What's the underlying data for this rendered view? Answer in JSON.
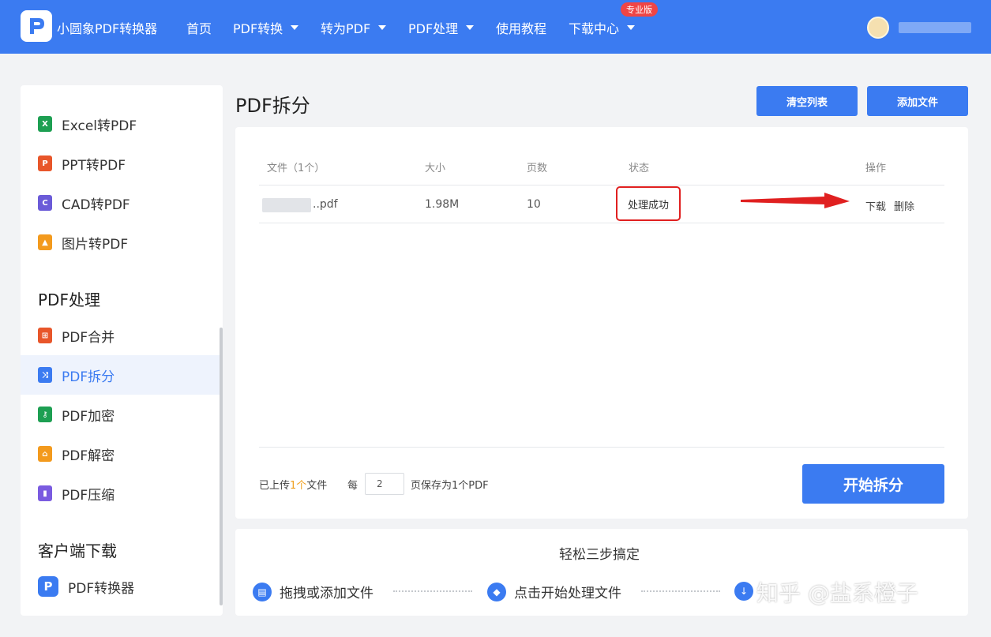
{
  "brand": {
    "name": "小圆象PDF转换器",
    "logo_letter": "P"
  },
  "nav": {
    "items": [
      {
        "label": "首页"
      },
      {
        "label": "PDF转换"
      },
      {
        "label": "转为PDF"
      },
      {
        "label": "PDF处理"
      },
      {
        "label": "使用教程"
      },
      {
        "label": "下载中心"
      }
    ],
    "badge": "专业版"
  },
  "sidebar": {
    "convert_items": [
      {
        "label": "Excel转PDF",
        "icon": "excel-icon",
        "letter": "X",
        "color": "#1d9f52"
      },
      {
        "label": "PPT转PDF",
        "icon": "ppt-icon",
        "letter": "P",
        "color": "#e8562a"
      },
      {
        "label": "CAD转PDF",
        "icon": "cad-icon",
        "letter": "C",
        "color": "#6b5bd8"
      },
      {
        "label": "图片转PDF",
        "icon": "image-icon",
        "letter": "▲",
        "color": "#f39a1d"
      }
    ],
    "section_process": "PDF处理",
    "process_items": [
      {
        "label": "PDF合并",
        "icon": "merge-icon",
        "letter": "⊞",
        "color": "#e8562a"
      },
      {
        "label": "PDF拆分",
        "icon": "split-icon",
        "letter": "⤨",
        "color": "#3b7bf1"
      },
      {
        "label": "PDF加密",
        "icon": "lock-icon",
        "letter": "⚷",
        "color": "#1d9f52"
      },
      {
        "label": "PDF解密",
        "icon": "unlock-icon",
        "letter": "⌂",
        "color": "#f39a1d"
      },
      {
        "label": "PDF压缩",
        "icon": "compress-icon",
        "letter": "▮",
        "color": "#7a5be0"
      }
    ],
    "section_download": "客户端下载",
    "download_item": {
      "label": "PDF转换器",
      "letter": "P"
    }
  },
  "main": {
    "title": "PDF拆分",
    "clear_button": "清空列表",
    "add_button": "添加文件",
    "table": {
      "headers": {
        "file": "文件（1个）",
        "size": "大小",
        "pages": "页数",
        "status": "状态",
        "ops": "操作"
      },
      "row": {
        "name": "..pdf",
        "size": "1.98M",
        "pages": "10",
        "status": "处理成功",
        "download": "下载",
        "delete": "删除"
      }
    },
    "footer": {
      "uploaded_prefix": "已上传",
      "uploaded_count": "1个",
      "uploaded_suffix": "文件",
      "every": "每",
      "pages_value": "2",
      "save_as": "页保存为1个PDF",
      "start_button": "开始拆分"
    }
  },
  "steps": {
    "title": "轻松三步搞定",
    "items": [
      {
        "label": "拖拽或添加文件"
      },
      {
        "label": "点击开始处理文件"
      }
    ]
  },
  "watermark": "知乎 @盐系橙子",
  "colors": {
    "primary": "#3b7bf1",
    "annotation": "#e02020",
    "badge": "#ef4545"
  }
}
